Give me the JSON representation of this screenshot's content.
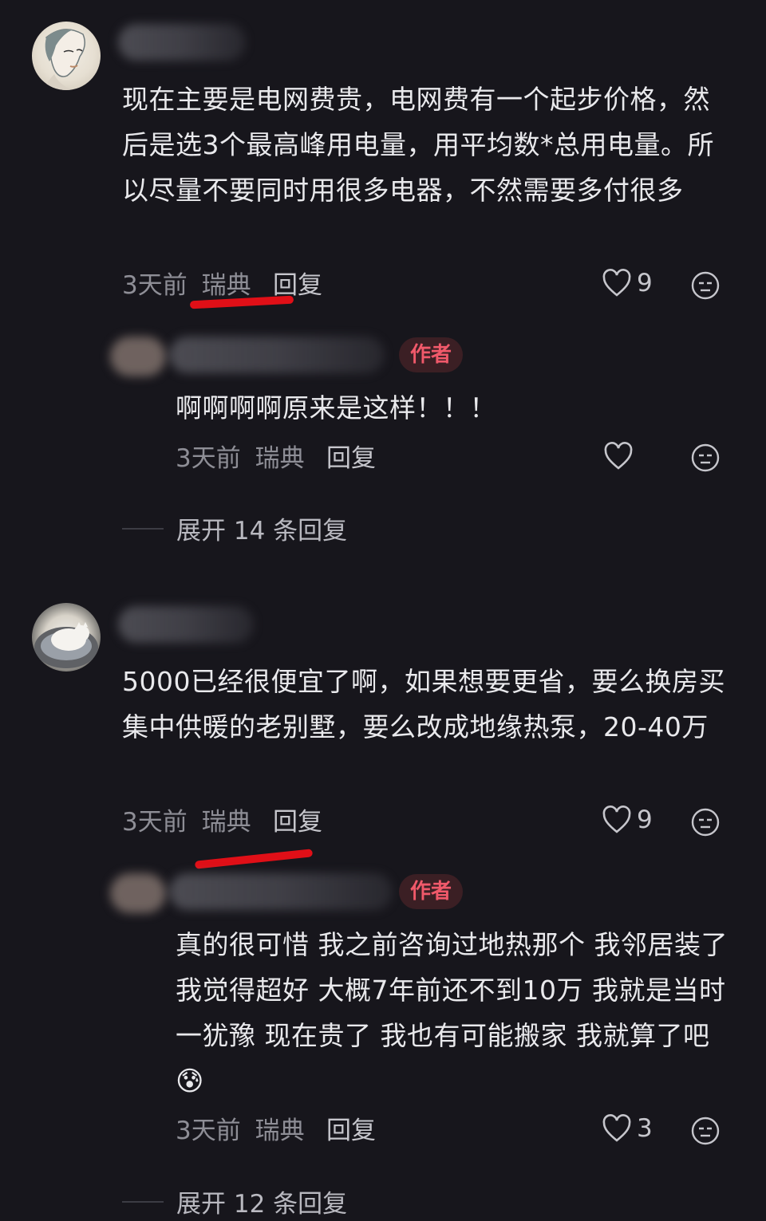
{
  "comments": [
    {
      "text": "现在主要是电网费贵，电网费有一个起步价格，然后是选3个最高峰用电量，用平均数*总用电量。所以尽量不要同时用很多电器，不然需要多付很多",
      "time": "3天前",
      "location": "瑞典",
      "reply_label": "回复",
      "likes": "9"
    },
    {
      "text": "5000已经很便宜了啊，如果想要更省，要么换房买集中供暖的老别墅，要么改成地缘热泵，20-40万",
      "time": "3天前",
      "location": "瑞典",
      "reply_label": "回复",
      "likes": "9"
    }
  ],
  "replies": [
    {
      "badge": "作者",
      "text": "啊啊啊啊原来是这样！！！",
      "time": "3天前",
      "location": "瑞典",
      "reply_label": "回复",
      "likes": "",
      "expand": "展开 14 条回复"
    },
    {
      "badge": "作者",
      "text": "真的很可惜 我之前咨询过地热那个 我邻居装了 我觉得超好 大概7年前还不到10万 我就是当时一犹豫 现在贵了 我也有可能搬家 我就算了吧",
      "emoji": "😰",
      "time": "3天前",
      "location": "瑞典",
      "reply_label": "回复",
      "likes": "3",
      "expand": "展开 12 条回复"
    }
  ],
  "icons": [
    "heart-icon",
    "dislike-icon",
    "avatar",
    "anxious-emoji-icon"
  ],
  "colors": {
    "background": "#17161c",
    "badge": "#f0596a",
    "annotation": "#e00f17"
  }
}
